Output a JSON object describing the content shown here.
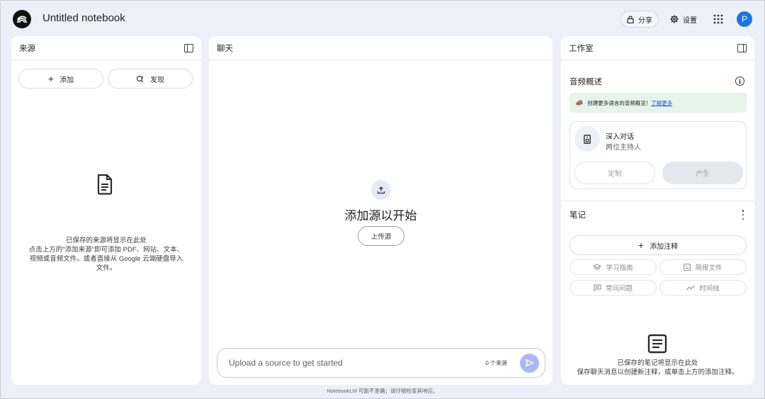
{
  "header": {
    "title": "Untitled notebook",
    "share_label": "分享",
    "settings_label": "设置",
    "avatar_initial": "P"
  },
  "sources": {
    "title": "来源",
    "add_label": "添加",
    "discover_label": "发现",
    "empty_title": "已保存的来源将显示在此处",
    "empty_line1": "点击上方的\"添加来源\"即可添加 PDF、网站、文本、",
    "empty_line2": "视频或音频文件。或者直接从 Google 云端硬盘导入",
    "empty_line3": "文件。"
  },
  "chat": {
    "title": "聊天",
    "empty_title": "添加源以开始",
    "upload_label": "上传源",
    "input_placeholder": "Upload a source to get started",
    "source_count": "0 个来源"
  },
  "footer": "NotebookLM 可能不准确；请仔细检查其响应。",
  "studio": {
    "title": "工作室",
    "audio_overview": "音频概述",
    "banner_text": "创建更多语言的音频概览！",
    "banner_link": "了解更多",
    "card_title": "深入对话",
    "card_subtitle": "两位主持人",
    "customize_label": "定制",
    "generate_label": "产生",
    "notes_title": "笔记",
    "add_note_label": "添加注释",
    "study_guide": "学习指南",
    "briefing_doc": "简报文件",
    "faq": "常问问题",
    "timeline": "时间线",
    "notes_empty_title": "已保存的笔记将显示在此处",
    "notes_empty_desc": "保存聊天消息以创建新注释，或单击上方的添加注释。"
  },
  "colors": {
    "background": "#eef0f9",
    "panel": "#ffffff",
    "accent": "#1a73e8",
    "send": "#a9b8f5",
    "banner": "#e6f4ea"
  }
}
